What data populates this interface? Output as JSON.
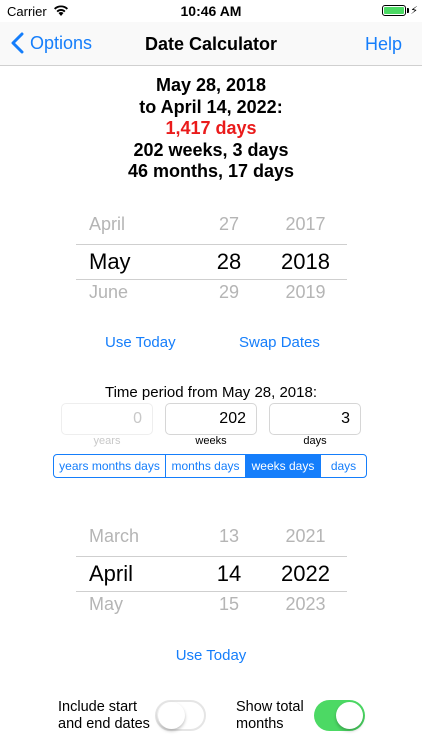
{
  "status_bar": {
    "carrier": "Carrier",
    "time": "10:46 AM"
  },
  "nav": {
    "back_label": "Options",
    "title": "Date Calculator",
    "help_label": "Help"
  },
  "result": {
    "line1": "May 28, 2018",
    "line2": "to April 14, 2022:",
    "days": "1,417 days",
    "weeks": "202 weeks, 3 days",
    "months": "46 months, 17 days",
    "highlight_color": "#ea1b1b"
  },
  "start_picker": {
    "prev": {
      "month": "April",
      "day": "27",
      "year": "2017"
    },
    "selected": {
      "month": "May",
      "day": "28",
      "year": "2018"
    },
    "next": {
      "month": "June",
      "day": "29",
      "year": "2019"
    }
  },
  "start_actions": {
    "use_today": "Use Today",
    "swap_dates": "Swap Dates"
  },
  "period": {
    "label": "Time period from May 28, 2018:",
    "fields": [
      {
        "label": "years",
        "value": "0"
      },
      {
        "label": "weeks",
        "value": "202"
      },
      {
        "label": "days",
        "value": "3"
      }
    ]
  },
  "segmented": {
    "options": [
      "years months days",
      "months days",
      "weeks days",
      "days"
    ],
    "selected": "weeks days"
  },
  "end_picker": {
    "prev": {
      "month": "March",
      "day": "13",
      "year": "2021"
    },
    "selected": {
      "month": "April",
      "day": "14",
      "year": "2022"
    },
    "next": {
      "month": "May",
      "day": "15",
      "year": "2023"
    }
  },
  "end_actions": {
    "use_today": "Use Today"
  },
  "toggles": {
    "include_dates": {
      "label_line1": "Include start",
      "label_line2": "and end dates",
      "on": false
    },
    "show_months": {
      "label_line1": "Show total",
      "label_line2": "months",
      "on": true
    }
  },
  "colors": {
    "accent": "#157efb",
    "switch_on": "#4cd964"
  }
}
